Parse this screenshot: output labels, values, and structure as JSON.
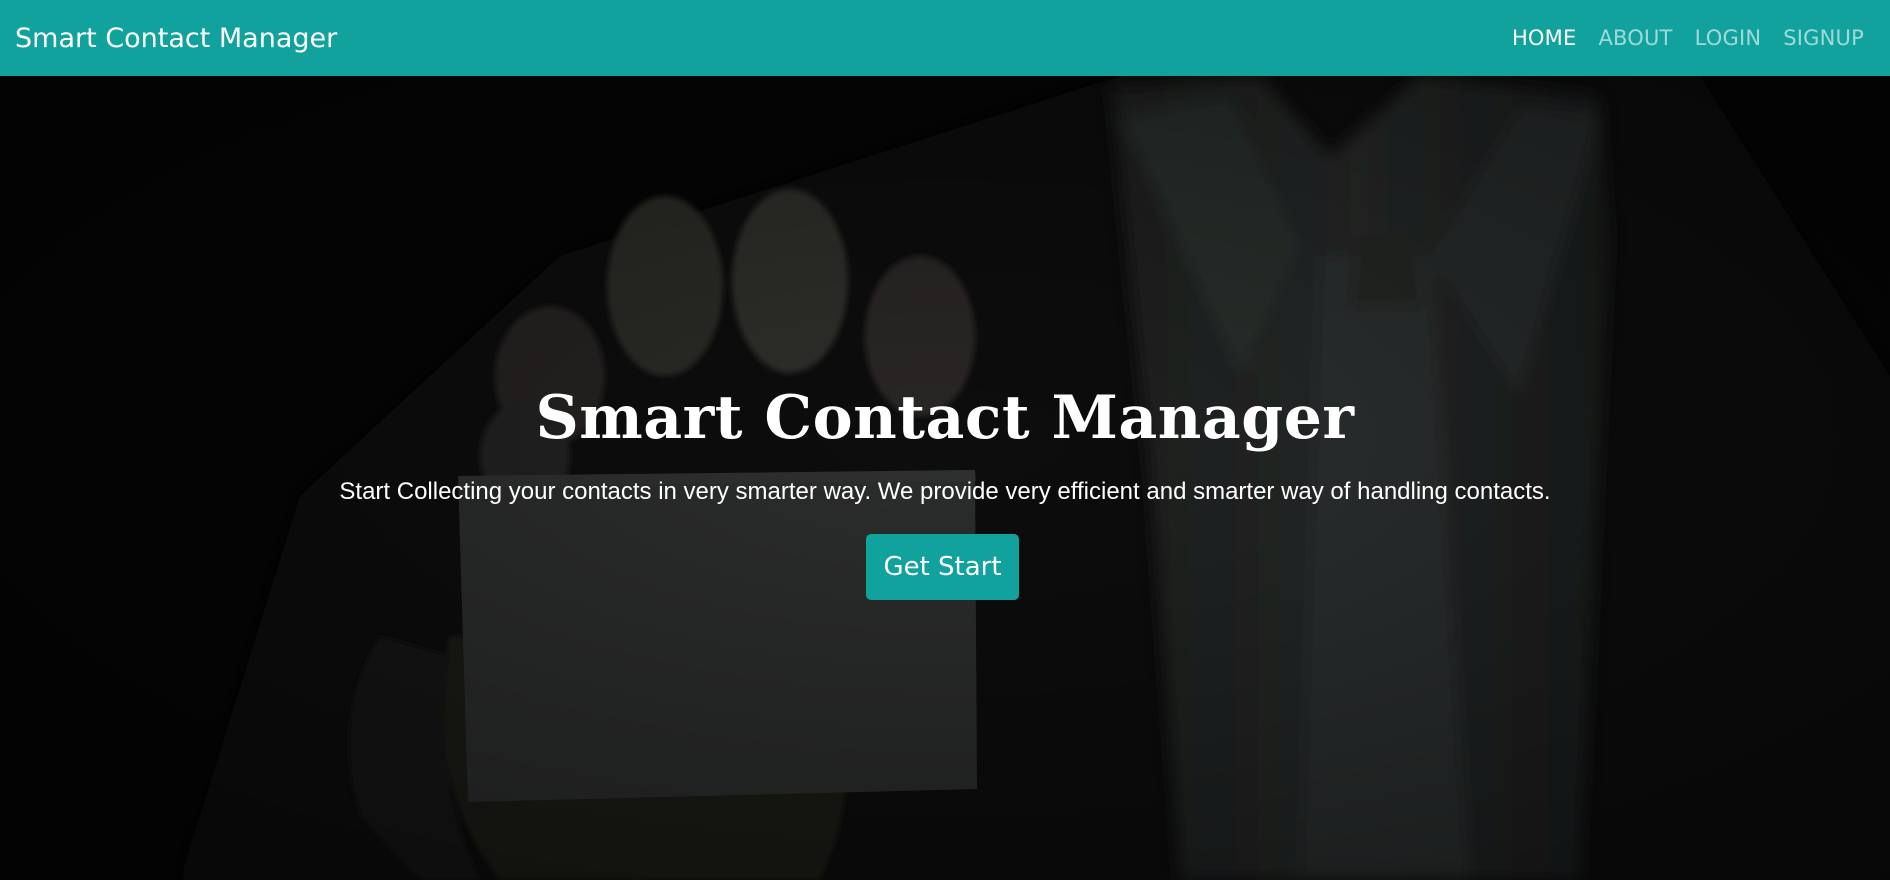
{
  "navbar": {
    "brand": "Smart Contact Manager",
    "links": [
      {
        "label": "HOME",
        "active": true
      },
      {
        "label": "ABOUT",
        "active": false
      },
      {
        "label": "LOGIN",
        "active": false
      },
      {
        "label": "SIGNUP",
        "active": false
      }
    ],
    "background": "#11a29e"
  },
  "hero": {
    "title": "Smart Contact Manager",
    "subtitle": "Start Collecting your contacts in very smarter way. We provide very efficient and smarter way of handling contacts.",
    "button_label": "Get Start",
    "background_image": "dark photo of a person in a suit holding a blank business card"
  }
}
